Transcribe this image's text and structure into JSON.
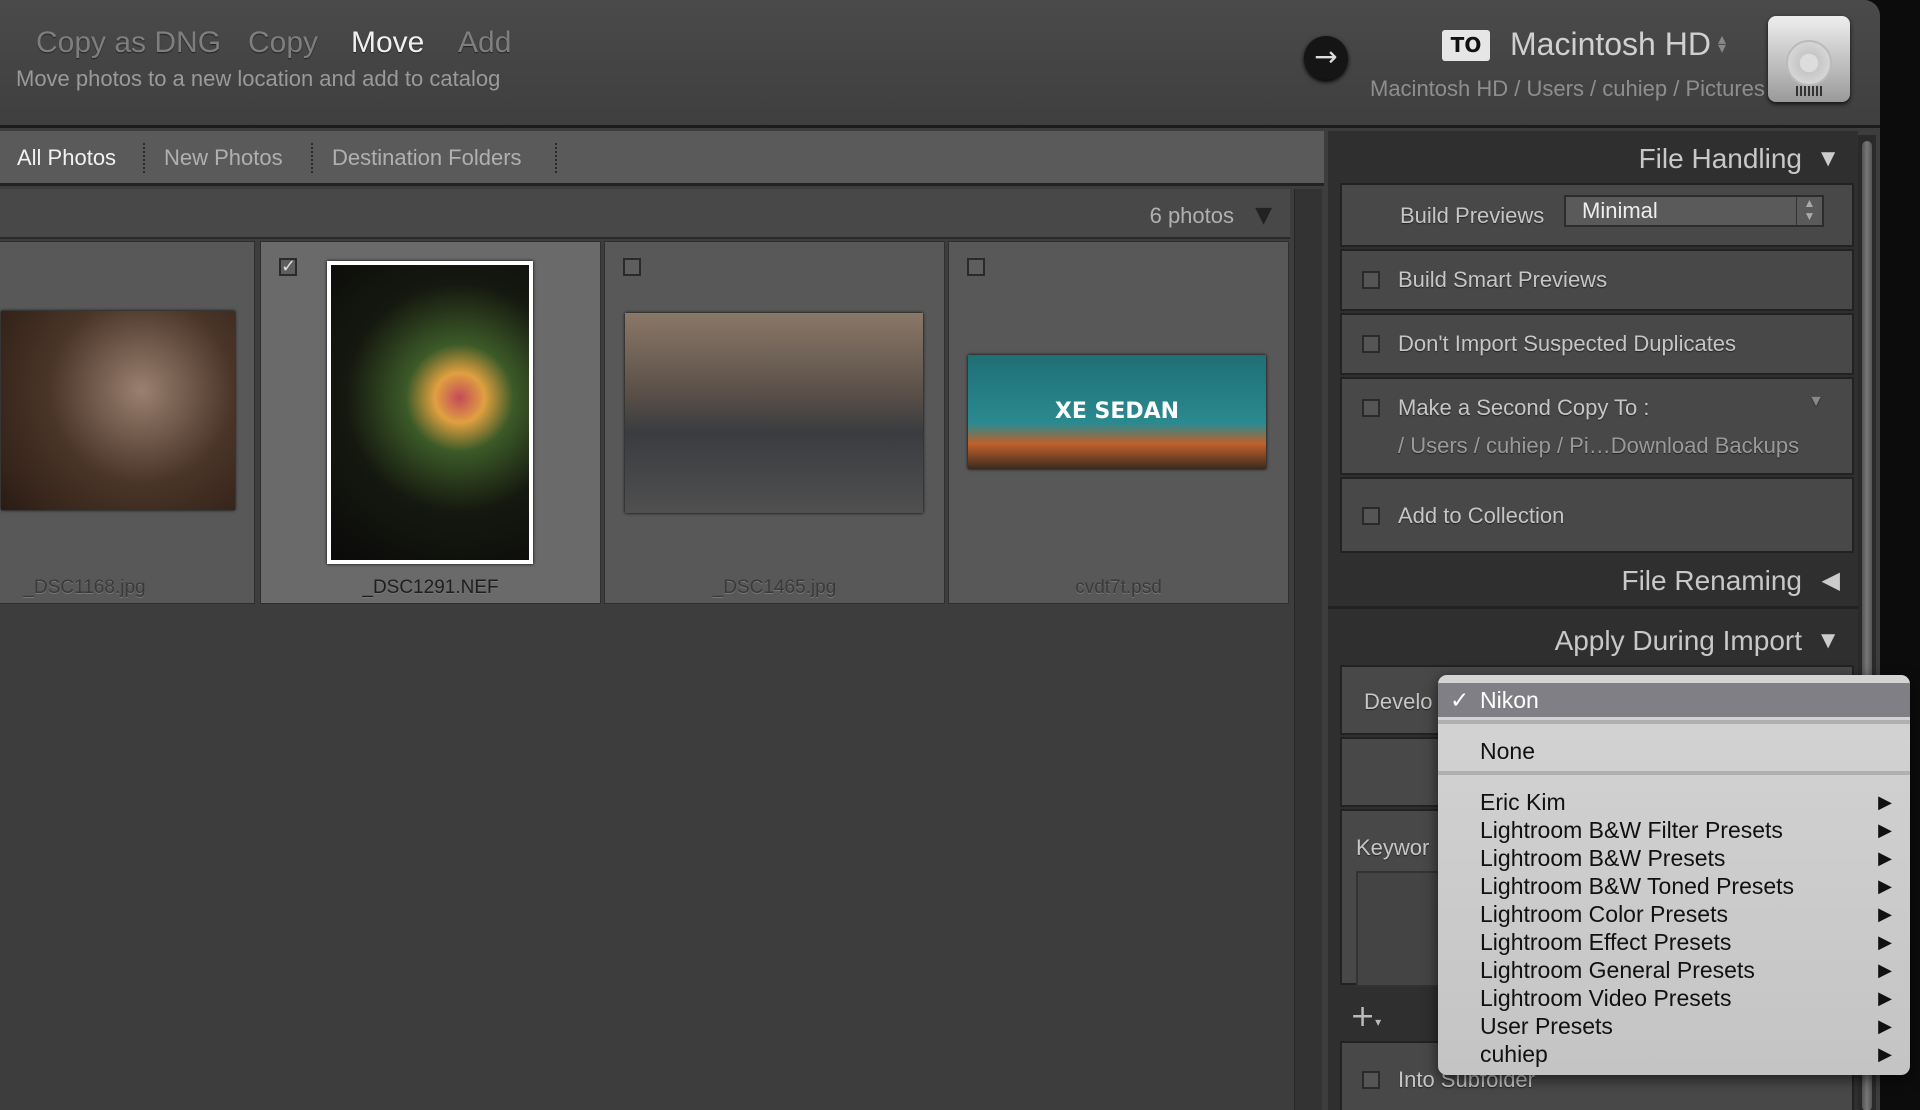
{
  "top_bar": {
    "modes": [
      {
        "label": "Copy as DNG",
        "active": false
      },
      {
        "label": "Copy",
        "active": false
      },
      {
        "label": "Move",
        "active": true
      },
      {
        "label": "Add",
        "active": false
      }
    ],
    "mode_description": "Move photos to a new location and add to catalog",
    "to_badge": "TO",
    "destination_name": "Macintosh HD",
    "destination_path": "Macintosh HD / Users / cuhiep / Pictures"
  },
  "tabs": [
    {
      "label": "All Photos",
      "active": true
    },
    {
      "label": "New Photos",
      "active": false
    },
    {
      "label": "Destination Folders",
      "active": false
    }
  ],
  "grid": {
    "photo_count": "6 photos",
    "photos": [
      {
        "filename": "_DSC1168.jpg",
        "checked": false,
        "selected": false
      },
      {
        "filename": "_DSC1291.NEF",
        "checked": true,
        "selected": true
      },
      {
        "filename": "_DSC1465.jpg",
        "checked": false,
        "selected": false
      },
      {
        "filename": "cvdt7t.psd",
        "checked": false,
        "selected": false
      }
    ],
    "thumb_text": "XE SEDAN"
  },
  "panel": {
    "file_handling": {
      "title": "File Handling",
      "build_previews_label": "Build Previews",
      "build_previews_value": "Minimal",
      "build_smart_previews": "Build Smart Previews",
      "dont_import_duplicates": "Don't Import Suspected Duplicates",
      "second_copy_label": "Make a Second Copy To :",
      "second_copy_path": "/ Users / cuhiep / Pi…Download Backups",
      "add_to_collection": "Add to Collection"
    },
    "file_renaming": {
      "title": "File Renaming"
    },
    "apply_during_import": {
      "title": "Apply During Import",
      "develop_label": "Develo",
      "keywords_label": "Keywor"
    },
    "into_subfolder": "Into Subfolder"
  },
  "develop_menu": {
    "selected": "Nikon",
    "check": "✓",
    "none": "None",
    "submenus": [
      "Eric Kim",
      "Lightroom B&W Filter Presets",
      "Lightroom B&W Presets",
      "Lightroom B&W Toned Presets",
      "Lightroom Color Presets",
      "Lightroom Effect Presets",
      "Lightroom General Presets",
      "Lightroom Video Presets",
      "User Presets",
      "cuhiep"
    ]
  }
}
